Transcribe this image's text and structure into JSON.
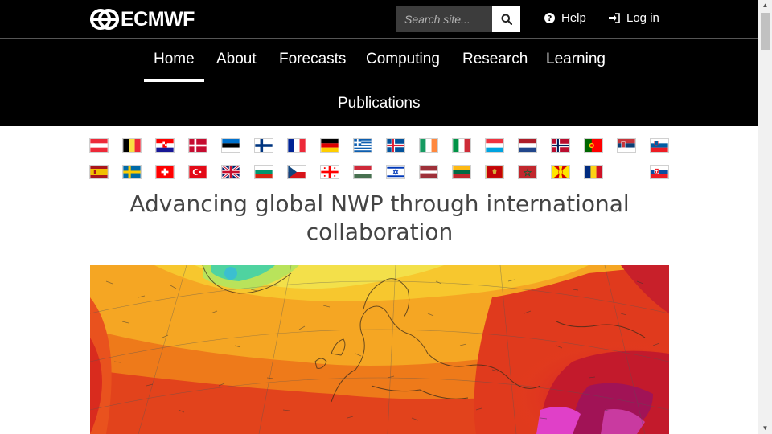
{
  "header": {
    "logo_text": "ECMWF",
    "search_placeholder": "Search site...",
    "help_label": "Help",
    "login_label": "Log in"
  },
  "nav": {
    "items": [
      {
        "label": "Home",
        "active": true
      },
      {
        "label": "About"
      },
      {
        "label": "Forecasts"
      },
      {
        "label": "Computing"
      },
      {
        "label": "Research"
      },
      {
        "label": "Learning"
      },
      {
        "label": "Publications"
      }
    ]
  },
  "flags": {
    "row1": [
      "austria",
      "belgium",
      "croatia",
      "denmark",
      "estonia",
      "finland",
      "france",
      "germany",
      "greece",
      "iceland",
      "ireland",
      "italy",
      "luxembourg",
      "netherlands",
      "norway",
      "portugal",
      "serbia",
      "slovenia"
    ],
    "row2": [
      "spain",
      "sweden",
      "switzerland",
      "turkey",
      "united-kingdom",
      "bulgaria",
      "czech-republic",
      "georgia",
      "hungary",
      "israel",
      "latvia",
      "lithuania",
      "montenegro",
      "morocco",
      "north-macedonia",
      "romania",
      "slovakia"
    ]
  },
  "hero": {
    "title": "Advancing global NWP through international collaboration"
  },
  "colors": {
    "header_bg": "#000000",
    "title_text": "#444444"
  }
}
